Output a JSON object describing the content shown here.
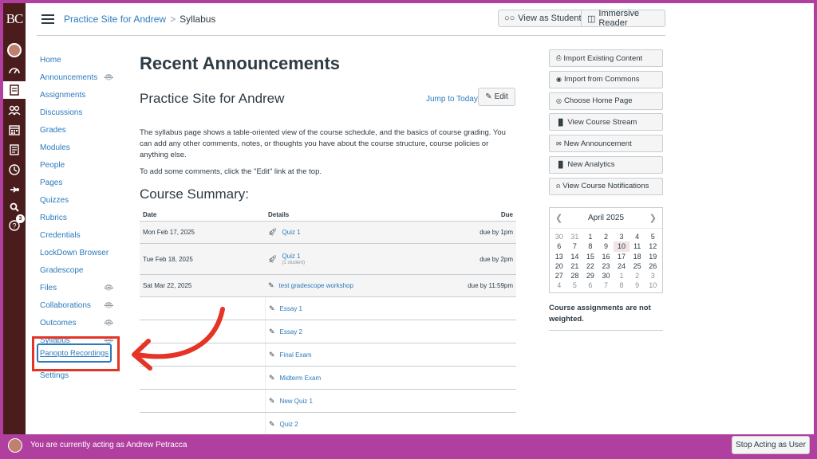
{
  "global_nav": {
    "logo": "BC",
    "badge_count": "3",
    "items": [
      "account",
      "dashboard",
      "courses",
      "groups",
      "calendar",
      "inbox",
      "history",
      "commons",
      "search",
      "help"
    ]
  },
  "header": {
    "breadcrumb_course": "Practice Site for Andrew",
    "breadcrumb_separator": ">",
    "breadcrumb_current": "Syllabus",
    "view_as_student": "View as Student",
    "immersive_reader": "Immersive Reader"
  },
  "course_nav": [
    {
      "label": "Home",
      "hidden": false
    },
    {
      "label": "Announcements",
      "hidden": true
    },
    {
      "label": "Assignments",
      "hidden": false
    },
    {
      "label": "Discussions",
      "hidden": false
    },
    {
      "label": "Grades",
      "hidden": false
    },
    {
      "label": "Modules",
      "hidden": false
    },
    {
      "label": "People",
      "hidden": false
    },
    {
      "label": "Pages",
      "hidden": false
    },
    {
      "label": "Quizzes",
      "hidden": false
    },
    {
      "label": "Rubrics",
      "hidden": false
    },
    {
      "label": "Credentials",
      "hidden": false
    },
    {
      "label": "LockDown Browser",
      "hidden": false
    },
    {
      "label": "Gradescope",
      "hidden": false
    },
    {
      "label": "Files",
      "hidden": true
    },
    {
      "label": "Collaborations",
      "hidden": true
    },
    {
      "label": "Outcomes",
      "hidden": true
    },
    {
      "label": "Syllabus",
      "hidden": true
    },
    {
      "label": "Panopto Recordings",
      "hidden": false
    },
    {
      "label": "Settings",
      "hidden": false
    }
  ],
  "main": {
    "announcements_title": "Recent Announcements",
    "site_title": "Practice Site for Andrew",
    "jump_to_today": "Jump to Today",
    "edit_label": "Edit",
    "intro": "The syllabus page shows a table-oriented view of the course schedule, and the basics of course grading. You can add any other comments, notes, or thoughts you have about the course structure, course policies or anything else.",
    "intro2": "To add some comments, click the \"Edit\" link at the top.",
    "course_summary_title": "Course Summary:",
    "table_headers": {
      "date": "Date",
      "details": "Details",
      "due": "Due"
    },
    "rows": [
      {
        "date": "Mon Feb 17, 2025",
        "icon": "quiz-icon",
        "title": "Quiz 1",
        "sub": "",
        "due": "due by 1pm"
      },
      {
        "date": "Tue Feb 18, 2025",
        "icon": "quiz-icon",
        "title": "Quiz 1",
        "sub": "(1 student)",
        "due": "due by 2pm"
      },
      {
        "date": "Sat Mar 22, 2025",
        "icon": "assignment-icon",
        "title": "test gradescope workshop",
        "sub": "",
        "due": "due by 11:59pm"
      },
      {
        "date": "",
        "icon": "assignment-icon",
        "title": "Essay 1",
        "sub": "",
        "due": ""
      },
      {
        "date": "",
        "icon": "assignment-icon",
        "title": "Essay 2",
        "sub": "",
        "due": ""
      },
      {
        "date": "",
        "icon": "assignment-icon",
        "title": "Final Exam",
        "sub": "",
        "due": ""
      },
      {
        "date": "",
        "icon": "assignment-icon",
        "title": "Midterm Exam",
        "sub": "",
        "due": ""
      },
      {
        "date": "",
        "icon": "assignment-icon",
        "title": "New Quiz 1",
        "sub": "",
        "due": ""
      },
      {
        "date": "",
        "icon": "assignment-icon",
        "title": "Quiz 2",
        "sub": "",
        "due": ""
      }
    ]
  },
  "sidebar": {
    "buttons": [
      {
        "label": "Import Existing Content",
        "icon": "import-icon"
      },
      {
        "label": "Import from Commons",
        "icon": "commons-icon"
      },
      {
        "label": "Choose Home Page",
        "icon": "target-icon"
      },
      {
        "label": "View Course Stream",
        "icon": "stats-icon"
      },
      {
        "label": "New Announcement",
        "icon": "announcement-icon"
      },
      {
        "label": "New Analytics",
        "icon": "stats-icon"
      },
      {
        "label": "View Course Notifications",
        "icon": "bell-icon"
      }
    ],
    "calendar": {
      "month": "April 2025",
      "days": [
        {
          "d": "30",
          "dim": true
        },
        {
          "d": "31",
          "dim": true
        },
        {
          "d": "1"
        },
        {
          "d": "2"
        },
        {
          "d": "3"
        },
        {
          "d": "4"
        },
        {
          "d": "5"
        },
        {
          "d": "6"
        },
        {
          "d": "7"
        },
        {
          "d": "8"
        },
        {
          "d": "9"
        },
        {
          "d": "10",
          "today": true
        },
        {
          "d": "11"
        },
        {
          "d": "12"
        },
        {
          "d": "13"
        },
        {
          "d": "14"
        },
        {
          "d": "15"
        },
        {
          "d": "16"
        },
        {
          "d": "17"
        },
        {
          "d": "18"
        },
        {
          "d": "19"
        },
        {
          "d": "20"
        },
        {
          "d": "21"
        },
        {
          "d": "22"
        },
        {
          "d": "23"
        },
        {
          "d": "24"
        },
        {
          "d": "25"
        },
        {
          "d": "26"
        },
        {
          "d": "27"
        },
        {
          "d": "28"
        },
        {
          "d": "29"
        },
        {
          "d": "30"
        },
        {
          "d": "1",
          "dim": true
        },
        {
          "d": "2",
          "dim": true
        },
        {
          "d": "3",
          "dim": true
        },
        {
          "d": "4",
          "dim": true
        },
        {
          "d": "5",
          "dim": true
        },
        {
          "d": "6",
          "dim": true
        },
        {
          "d": "7",
          "dim": true
        },
        {
          "d": "8",
          "dim": true
        },
        {
          "d": "9",
          "dim": true
        },
        {
          "d": "10",
          "dim": true
        }
      ]
    },
    "weighted_note": "Course assignments are not weighted."
  },
  "annotation": {
    "highlighted_label": "Panopto Recordings"
  },
  "footer": {
    "message": "You are currently acting as Andrew Petracca",
    "stop_button": "Stop Acting as User"
  },
  "colors": {
    "global_nav": "#4a1c1c",
    "accent_purple": "#b03fa0",
    "link_blue": "#2b7abc",
    "annotation_red": "#e53425"
  }
}
